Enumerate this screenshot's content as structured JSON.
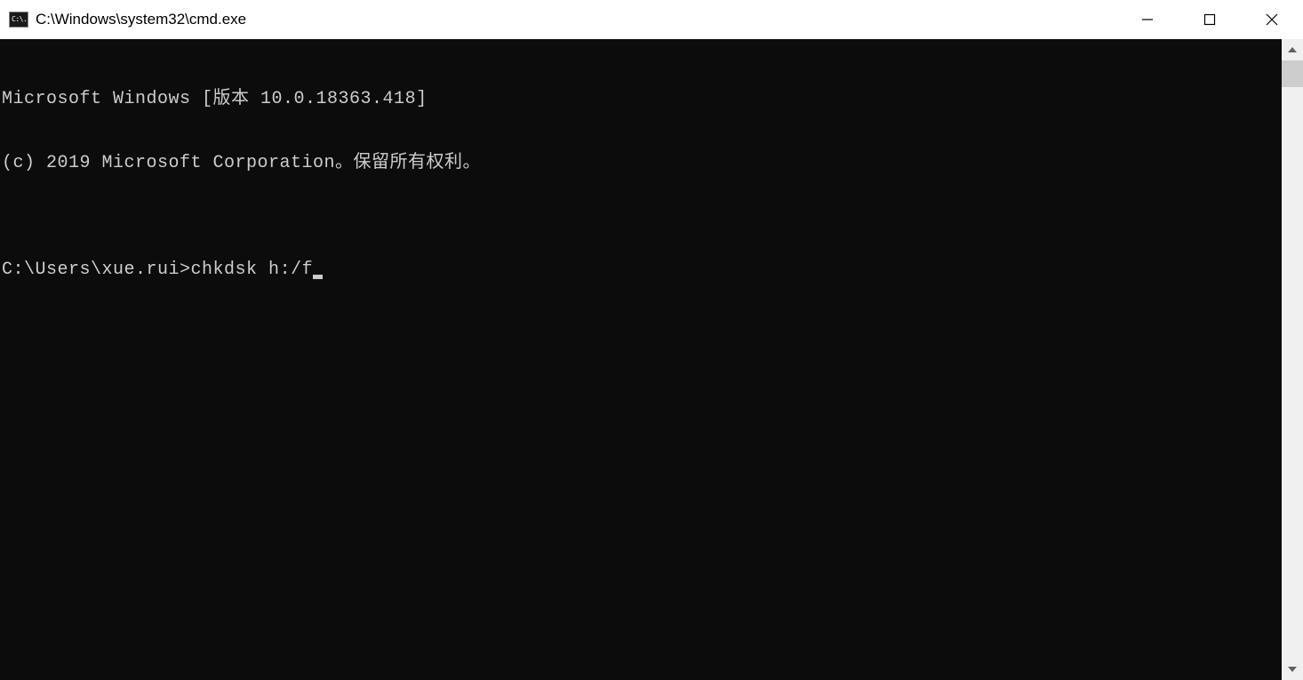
{
  "window": {
    "title": "C:\\Windows\\system32\\cmd.exe",
    "icon_text": "C:\\."
  },
  "console": {
    "line1": "Microsoft Windows [版本 10.0.18363.418]",
    "line2": "(c) 2019 Microsoft Corporation。保留所有权利。",
    "blank": "",
    "prompt": "C:\\Users\\xue.rui>",
    "command": "chkdsk h:/f"
  }
}
